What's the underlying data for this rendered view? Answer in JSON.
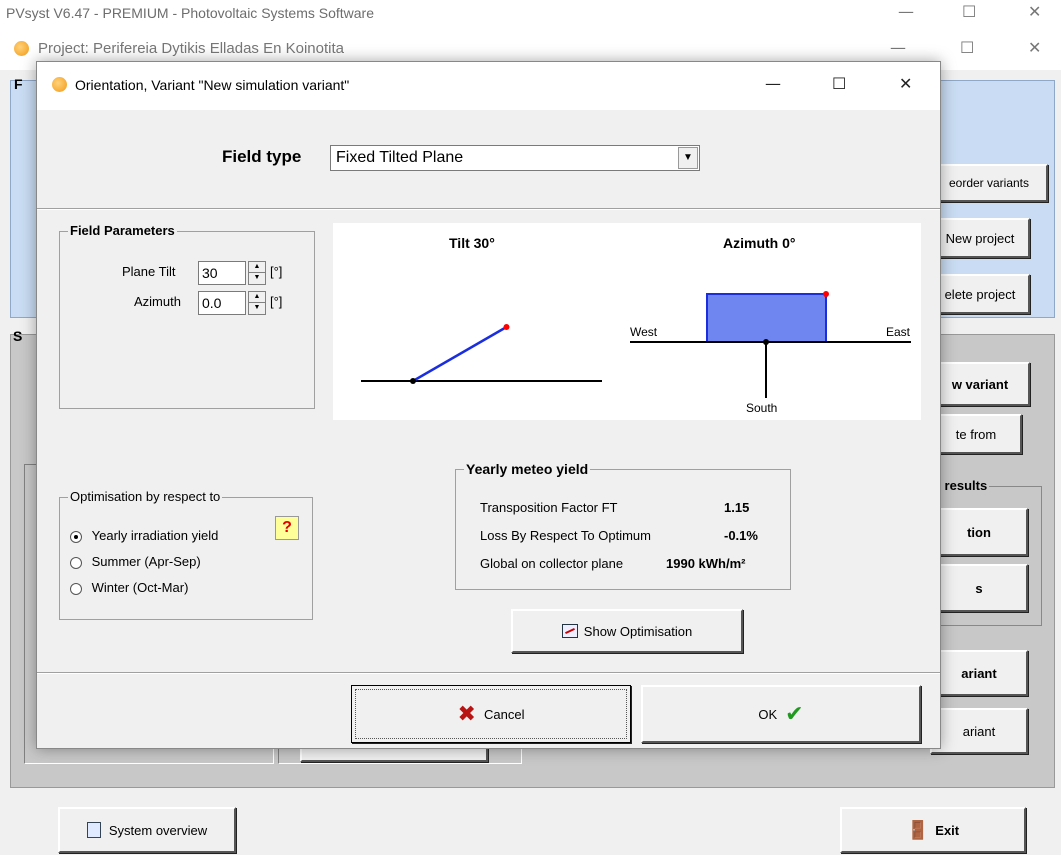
{
  "app": {
    "title": "PVsyst V6.47 - PREMIUM - Photovoltaic Systems Software"
  },
  "project": {
    "title": "Project:  Perifereia Dytikis Elladas En Koinotita",
    "right_buttons": {
      "reorder": "eorder variants",
      "new_project": "New project",
      "delete_project": "elete project",
      "new_variant": "w variant",
      "create_from": "te from",
      "results_legend": "d results",
      "simulation": "tion",
      "reports": "s",
      "delete_variant": "ariant",
      "save_variant": "ariant"
    },
    "system_overview": "System overview",
    "exit": "Exit",
    "left_letter_top": "F",
    "left_letter_mid": "S"
  },
  "dialog": {
    "title": "Orientation, Variant \"New simulation variant\"",
    "field_type_label": "Field type",
    "field_type_value": "Fixed Tilted Plane",
    "field_parameters": {
      "legend": "Field Parameters",
      "plane_tilt_label": "Plane Tilt",
      "plane_tilt_value": "30",
      "azimuth_label": "Azimuth",
      "azimuth_value": "0.0",
      "unit": "[°]"
    },
    "diagram": {
      "tilt_title": "Tilt 30°",
      "azimuth_title": "Azimuth 0°",
      "west": "West",
      "east": "East",
      "south": "South",
      "plane_color": "#6f86f0",
      "line_color": "#1a2ee0",
      "marker_color": "#ff0000"
    },
    "optimisation": {
      "legend": "Optimisation by respect to",
      "help": "?",
      "options": [
        {
          "label": "Yearly irradiation yield",
          "selected": true
        },
        {
          "label": "Summer (Apr-Sep)",
          "selected": false
        },
        {
          "label": "Winter (Oct-Mar)",
          "selected": false
        }
      ]
    },
    "meteo": {
      "legend": "Yearly meteo yield",
      "rows": [
        {
          "label": "Transposition Factor FT",
          "value": "1.15"
        },
        {
          "label": "Loss By Respect To Optimum",
          "value": "-0.1%"
        },
        {
          "label": "Global on collector plane",
          "value": "1990 kWh/m²"
        }
      ]
    },
    "show_optimisation": "Show Optimisation",
    "cancel": "Cancel",
    "ok": "OK"
  }
}
